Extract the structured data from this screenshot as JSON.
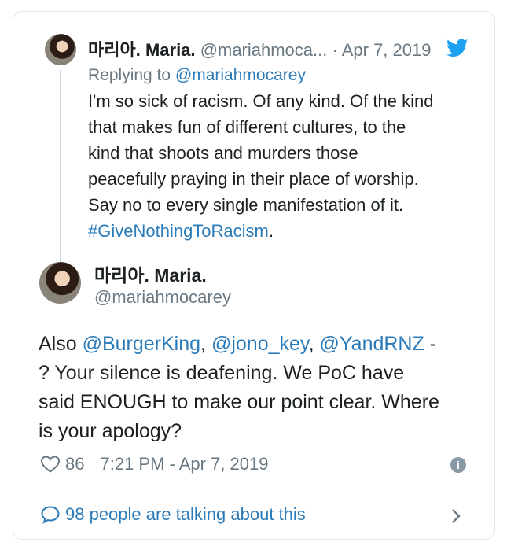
{
  "quoted": {
    "name": "마리아. Maria.",
    "handle": "@mariahmoca...",
    "date": "· Apr 7, 2019",
    "replying_prefix": "Replying to",
    "replying_handle": "@mariahmocarey",
    "text_lines": [
      "I'm so sick of racism. Of any kind. Of the kind",
      "that makes fun of different cultures, to the",
      "kind that shoots and murders those",
      "peacefully praying in their place of worship.",
      "Say no to every single manifestation of it."
    ],
    "hashtag": "#GiveNothingToRacism",
    "hashtag_trail": "."
  },
  "main": {
    "name": "마리아. Maria.",
    "handle": "@mariahmocarey",
    "text_prefix": "Also ",
    "mentions": [
      "@BurgerKing",
      "@jono_key",
      "@YandRNZ"
    ],
    "sep1": ", ",
    "sep2": ", ",
    "text_rest_line1": " -",
    "text_lines": [
      "? Your silence is deafening. We PoC have",
      "said ENOUGH to make our point clear. Where",
      "is your apology?"
    ]
  },
  "meta": {
    "likes": "86",
    "timestamp": "7:21 PM - Apr 7, 2019",
    "info_glyph": "i"
  },
  "footer": {
    "talking": "98 people are talking about this"
  },
  "colors": {
    "link": "#2b7bb9",
    "muted": "#697882",
    "text": "#1c2022",
    "twitter_blue": "#1da1f2"
  },
  "icons": [
    "twitter-bird-icon",
    "heart-icon",
    "info-icon",
    "chat-bubble-icon",
    "chevron-right-icon"
  ]
}
